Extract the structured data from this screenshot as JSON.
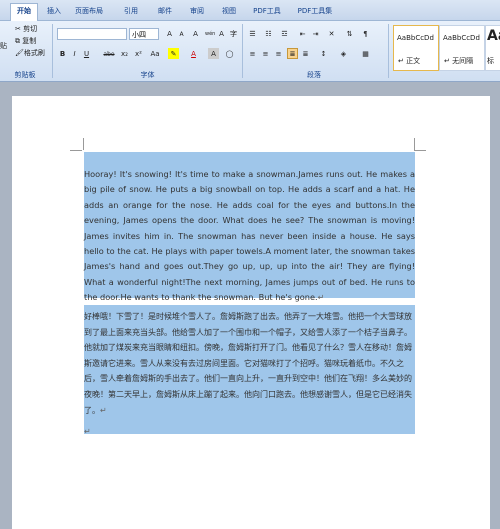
{
  "tabs": [
    "开始",
    "插入",
    "页面布局",
    "引用",
    "邮件",
    "审阅",
    "视图",
    "PDF工具",
    "PDF工具集"
  ],
  "clipboard": {
    "cut": "剪切",
    "copy": "复制",
    "format_painter": "格式刷",
    "paste": "贴",
    "label": "剪贴板"
  },
  "font": {
    "name": "",
    "size": "小四",
    "label": "字体",
    "grow": "A",
    "shrink": "A",
    "clear": "A",
    "wen": "wén",
    "bold": "B",
    "italic": "I",
    "underline": "U",
    "strike": "abe",
    "sub": "x₂",
    "sup": "x²",
    "case": "Aa",
    "color": "A",
    "char_border": "A",
    "char_shade": "A",
    "enclose": "字"
  },
  "paragraph": {
    "label": "段落"
  },
  "styles": [
    {
      "preview": "AaBbCcDd",
      "name": "↵ 正文"
    },
    {
      "preview": "AaBbCcDd",
      "name": "↵ 无间隔"
    },
    {
      "preview": "Aa",
      "name": "标"
    }
  ],
  "document": {
    "english": "Hooray! It's snowing! It's time to make a snowman.James runs out. He makes a big pile of snow. He puts a big snowball on top. He adds a scarf and a hat. He adds an orange for the nose. He adds coal for the eyes and buttons.In the evening, James opens the door. What does he see? The snowman is moving! James invites him in. The snowman has never been inside a house. He says hello to the cat. He plays with paper towels.A moment later, the snowman takes James's hand and goes out.They go up, up, up into the air! They are flying! What a wonderful night!The next morning, James jumps out of bed. He runs to the door.He wants to thank the snowman. But he's gone.",
    "chinese": "好棒哦！下雪了！是时候堆个雪人了。詹姆斯跑了出去。他弄了一大堆雪。他把一个大雪球放到了最上面来充当头部。他给雪人加了一个围巾和一个帽子，又给雪人添了一个桔子当鼻子。他就加了煤炭来充当眼睛和纽扣。傍晚，詹姆斯打开了门。他看见了什么？雪人在移动！詹姆斯邀请它进来。雪人从来没有去过房间里面。它对猫咪打了个招呼。猫咪玩着纸巾。不久之后，雪人牵着詹姆斯的手出去了。他们一直向上升，一直升到空中！他们在飞翔！多么美妙的夜晚！第二天早上，詹姆斯从床上蹦了起来。他向门口跑去。他想感谢雪人，但是它已经消失了。",
    "para_mark": "↵"
  },
  "watermark": "Bai 经验"
}
